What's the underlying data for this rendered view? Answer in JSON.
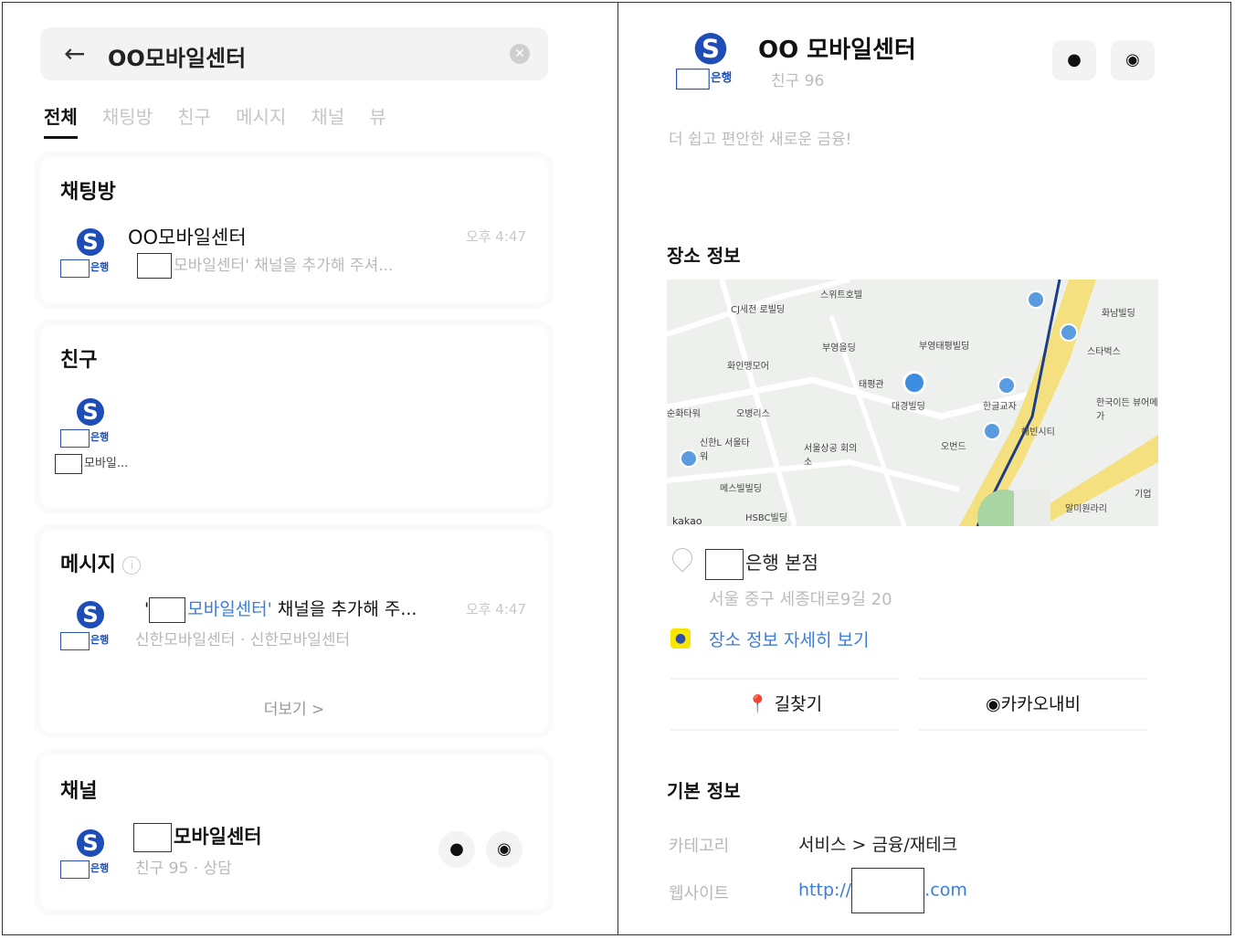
{
  "left": {
    "search_query": "OO모바일센터",
    "tabs": [
      "전체",
      "채팅방",
      "친구",
      "메시지",
      "채널",
      "뷰"
    ],
    "chatroom": {
      "title": "채팅방",
      "name": "OO모바일센터",
      "time": "오후 4:47",
      "preview": "모바일센터' 채널을 추가해 주셔..."
    },
    "friends": {
      "title": "친구",
      "name": "모바일..."
    },
    "messages": {
      "title": "메시지",
      "text_prefix": "'",
      "text_link": "모바일센터'",
      "text_rest": " 채널을 추가해 주...",
      "time": "오후 4:47",
      "sub": "신한모바일센터 · 신한모바일센터",
      "more": "더보기 >"
    },
    "channel": {
      "title": "채널",
      "name": "모바일센터",
      "sub": "친구 95 · 상담"
    },
    "bank_label": "은행"
  },
  "right": {
    "title": "OO 모바일센터",
    "friends": "친구 96",
    "tagline": "더 쉽고 편안한 새로운 금융!",
    "place_title": "장소 정보",
    "map_watermark": "kakao",
    "map_labels": [
      "스위트호텔",
      "CJ세전 로빌딩",
      "부영을딩",
      "부영태평빌딩",
      "화인맹모어",
      "태평관",
      "대경빌딩",
      "한글교자",
      "오병리스",
      "순화타워",
      "신한L 서울타워",
      "서울상공 회의소",
      "오번드",
      "메스빌빌딩",
      "HSBC빌딩",
      "해빈시티",
      "화남빌딩",
      "스타벅스",
      "한국이든 뷰어메가",
      "알미원라리",
      "기업"
    ],
    "branch": "은행 본점",
    "address": "서울 중구 세종대로9길 20",
    "detail_link": "장소 정보 자세히 보기",
    "btn_route": "길찾기",
    "btn_navi": "카카오내비",
    "basic_title": "기본 정보",
    "category_key": "카테고리",
    "category_val": "서비스 > 금융/재테크",
    "website_key": "웹사이트",
    "website_prefix": "http://",
    "website_suffix": ".com",
    "bank_label": "은행"
  }
}
